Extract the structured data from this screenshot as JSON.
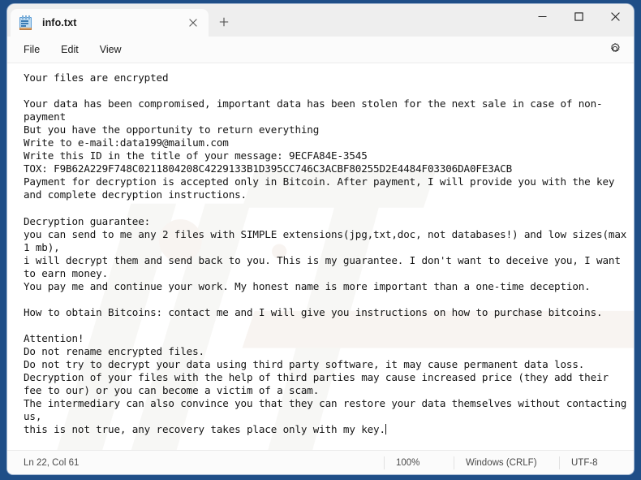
{
  "window": {
    "tab_label": "info.txt",
    "tab_icon": "notepad-icon",
    "close_tab_icon": "close-icon",
    "new_tab_icon": "plus-icon",
    "minimize_icon": "minimize-icon",
    "maximize_icon": "maximize-icon",
    "close_icon": "close-icon",
    "desktop_color": "#1f4e87"
  },
  "menu": {
    "items": [
      {
        "label": "File"
      },
      {
        "label": "Edit"
      },
      {
        "label": "View"
      }
    ],
    "settings_icon": "gear-icon"
  },
  "document": {
    "filename": "info.txt",
    "lines": [
      "Your files are encrypted",
      "",
      "Your data has been compromised, important data has been stolen for the next sale in case of non-payment",
      "But you have the opportunity to return everything",
      "Write to e-mail:data199@mailum.com",
      "Write this ID in the title of your message: 9ECFA84E-3545",
      "TOX: F9B62A229F748C0211804208C4229133B1D395CC746C3ACBF80255D2E4484F03306DA0FE3ACB",
      "Payment for decryption is accepted only in Bitcoin. After payment, I will provide you with the key and complete decryption instructions.",
      "",
      "Decryption guarantee:",
      "you can send to me any 2 files with SIMPLE extensions(jpg,txt,doc, not databases!) and low sizes(max 1 mb),",
      "i will decrypt them and send back to you. This is my guarantee. I don't want to deceive you, I want to earn money.",
      "You pay me and continue your work. My honest name is more important than a one-time deception.",
      "",
      "How to obtain Bitcoins: contact me and I will give you instructions on how to purchase bitcoins.",
      "",
      "Attention!",
      "Do not rename encrypted files.",
      "Do not try to decrypt your data using third party software, it may cause permanent data loss.",
      "Decryption of your files with the help of third parties may cause increased price (they add their fee to our) or you can become a victim of a scam.",
      "The intermediary can also convince you that they can restore your data themselves without contacting us,",
      "this is not true, any recovery takes place only with my key."
    ],
    "email": "data199@mailum.com",
    "id": "9ECFA84E-3545",
    "tox": "F9B62A229F748C0211804208C4229133B1D395CC746C3ACBF80255D2E4484F03306DA0FE3ACB"
  },
  "statusbar": {
    "line_col": "Ln 22, Col 61",
    "zoom": "100%",
    "line_ending": "Windows (CRLF)",
    "encoding": "UTF-8"
  }
}
